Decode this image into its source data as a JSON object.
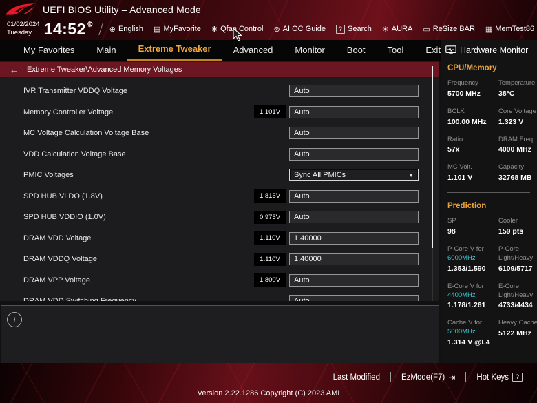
{
  "header": {
    "title": "UEFI BIOS Utility – Advanced Mode",
    "date": "01/02/2024",
    "day": "Tuesday",
    "time": "14:52",
    "toolbar": [
      {
        "icon": "globe-icon",
        "label": "English"
      },
      {
        "icon": "myfavorite-icon",
        "label": "MyFavorite"
      },
      {
        "icon": "qfan-icon",
        "label": "Qfan Control"
      },
      {
        "icon": "ai-oc-guide-icon",
        "label": "AI OC Guide"
      },
      {
        "icon": "search-icon",
        "label": "Search"
      },
      {
        "icon": "aura-icon",
        "label": "AURA"
      },
      {
        "icon": "resize-bar-icon",
        "label": "ReSize BAR"
      },
      {
        "icon": "memtest-icon",
        "label": "MemTest86"
      }
    ]
  },
  "menu": {
    "tabs": [
      {
        "label": "My Favorites",
        "active": false
      },
      {
        "label": "Main",
        "active": false
      },
      {
        "label": "Extreme Tweaker",
        "active": true
      },
      {
        "label": "Advanced",
        "active": false
      },
      {
        "label": "Monitor",
        "active": false
      },
      {
        "label": "Boot",
        "active": false
      },
      {
        "label": "Tool",
        "active": false
      },
      {
        "label": "Exit",
        "active": false
      }
    ]
  },
  "breadcrumb": {
    "back": "←",
    "text": "Extreme Tweaker\\Advanced Memory Voltages"
  },
  "settings": {
    "rows": [
      {
        "label": "IVR Transmitter VDDQ Voltage",
        "badge": "",
        "value": "Auto",
        "type": "input"
      },
      {
        "label": "Memory Controller Voltage",
        "badge": "1.101V",
        "value": "Auto",
        "type": "input"
      },
      {
        "label": "MC Voltage Calculation Voltage Base",
        "badge": "",
        "value": "Auto",
        "type": "input"
      },
      {
        "label": "VDD Calculation Voltage Base",
        "badge": "",
        "value": "Auto",
        "type": "input"
      },
      {
        "label": "PMIC Voltages",
        "badge": "",
        "value": "Sync All PMICs",
        "type": "select"
      },
      {
        "label": "SPD HUB VLDO (1.8V)",
        "badge": "1.815V",
        "value": "Auto",
        "type": "input"
      },
      {
        "label": "SPD HUB VDDIO (1.0V)",
        "badge": "0.975V",
        "value": "Auto",
        "type": "input"
      },
      {
        "label": "DRAM VDD Voltage",
        "badge": "1.110V",
        "value": "1.40000",
        "type": "input"
      },
      {
        "label": "DRAM VDDQ Voltage",
        "badge": "1.110V",
        "value": "1.40000",
        "type": "input"
      },
      {
        "label": "DRAM VPP Voltage",
        "badge": "1.800V",
        "value": "Auto",
        "type": "input"
      },
      {
        "label": "DRAM VDD Switching Frequency",
        "badge": "",
        "value": "Auto",
        "type": "input"
      }
    ]
  },
  "hardware_monitor": {
    "title": "Hardware Monitor",
    "sections": [
      {
        "title": "CPU/Memory",
        "divider_after": true,
        "pairs": [
          {
            "label": "Frequency",
            "value": "5700 MHz"
          },
          {
            "label": "Temperature",
            "value": "38°C"
          },
          {
            "label": "BCLK",
            "value": "100.00 MHz"
          },
          {
            "label": "Core Voltage",
            "value": "1.323 V"
          },
          {
            "label": "Ratio",
            "value": "57x"
          },
          {
            "label": "DRAM Freq.",
            "value": "4000 MHz"
          },
          {
            "label": "MC Volt.",
            "value": "1.101 V"
          },
          {
            "label": "Capacity",
            "value": "32768 MB"
          }
        ]
      },
      {
        "title": "Prediction",
        "divider_after": false,
        "pairs": [
          {
            "label": "SP",
            "value": "98"
          },
          {
            "label": "Cooler",
            "value": "159 pts"
          },
          {
            "label": "P-Core V for",
            "accent": "6000MHz",
            "value": "1.353/1.590"
          },
          {
            "label": "P-Core",
            "label2": "Light/Heavy",
            "value": "6109/5717"
          },
          {
            "label": "E-Core V for",
            "accent": "4400MHz",
            "value": "1.178/1.261"
          },
          {
            "label": "E-Core",
            "label2": "Light/Heavy",
            "value": "4733/4434"
          },
          {
            "label": "Cache V for",
            "accent": "5000MHz",
            "value": "1.314 V @L4"
          },
          {
            "label": "Heavy Cache",
            "value": "5122 MHz"
          }
        ]
      }
    ]
  },
  "footer": {
    "last_modified": "Last Modified",
    "ezmode": "EzMode(F7)",
    "hot_keys": "Hot Keys",
    "version": "Version 2.22.1286 Copyright (C) 2023 AMI"
  },
  "colors": {
    "rog_red": "#e4192b",
    "active_tab_gold": "#f2a83a",
    "section_orange": "#e8a23b",
    "accent_cyan": "#3ec6ce",
    "breadcrumb_red": "#6b1620"
  }
}
